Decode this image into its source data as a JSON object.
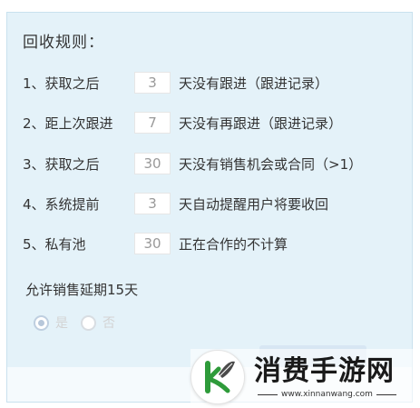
{
  "panel": {
    "title": "回收规则："
  },
  "rules": [
    {
      "label": "1、获取之后",
      "value": "3",
      "text": "天没有跟进（跟进记录）"
    },
    {
      "label": "2、距上次跟进",
      "value": "7",
      "text": "天没有再跟进（跟进记录）"
    },
    {
      "label": "3、获取之后",
      "value": "30",
      "text": "天没有销售机会或合同（>1）"
    },
    {
      "label": "4、系统提前",
      "value": "3",
      "text": "天自动提醒用户将要收回"
    },
    {
      "label": "5、私有池",
      "value": "30",
      "text": "正在合作的不计算"
    }
  ],
  "extension": {
    "label": "允许销售延期15天",
    "options": [
      {
        "label": "是",
        "checked": true
      },
      {
        "label": "否",
        "checked": false
      }
    ]
  },
  "watermark": {
    "brand": "消费手游网",
    "url": "www.xinnanwang.com",
    "logo_icon": "leaf-k-logo-icon"
  },
  "colors": {
    "panel_bg": "#e4f2f9",
    "text": "#333333",
    "input_text": "#999999",
    "radio_disabled": "#d3d3d3",
    "logo_green": "#2e9b3a"
  }
}
